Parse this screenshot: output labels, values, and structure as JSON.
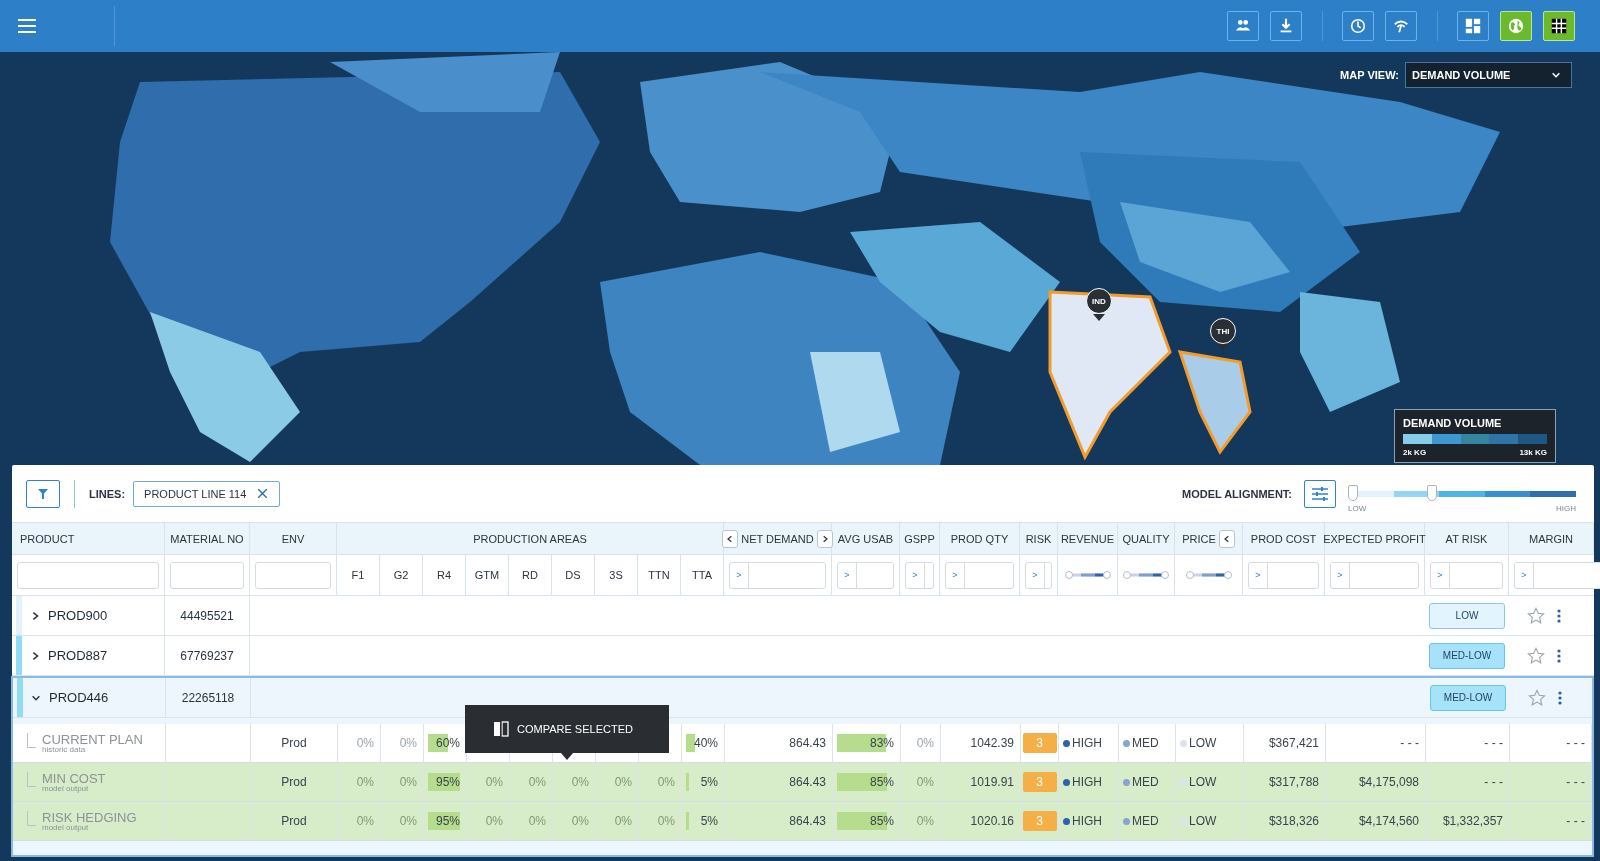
{
  "top_bar": {
    "buttons": [
      {
        "kind": "people",
        "selected": false
      },
      {
        "kind": "download",
        "selected": false
      },
      {
        "kind": "clock",
        "selected": false
      },
      {
        "kind": "signal",
        "selected": false
      },
      {
        "kind": "dashboard",
        "selected": false
      },
      {
        "kind": "globe",
        "selected": true
      },
      {
        "kind": "grid",
        "selected": true
      }
    ]
  },
  "map": {
    "view_label": "MAP VIEW:",
    "view_value": "DEMAND VOLUME",
    "pins": [
      "IND",
      "THI"
    ],
    "legend": {
      "title": "DEMAND VOLUME",
      "min": "2k KG",
      "max": "13k KG"
    }
  },
  "toolbar": {
    "lines_label": "LINES:",
    "chip": "PRODUCT LINE 114",
    "alignment_label": "MODEL ALIGNMENT:",
    "slider": {
      "level": 0.37,
      "min_label": "LOW",
      "max_label": "HIGH"
    }
  },
  "columns": [
    {
      "label": "PRODUCT",
      "kind": "text"
    },
    {
      "label": "MATERIAL NO",
      "kind": "text"
    },
    {
      "label": "ENV",
      "kind": "text"
    },
    {
      "label": "PRODUCTION AREAS",
      "kind": "group",
      "sub": [
        "F1",
        "G2",
        "R4",
        "GTM",
        "RD",
        "DS",
        "3S",
        "TTN",
        "TTA"
      ]
    },
    {
      "label": "NET DEMAND",
      "kind": "compare",
      "operator": ">",
      "nav_before": true,
      "nav_after": true
    },
    {
      "label": "AVG USAB",
      "kind": "compare",
      "operator": ">"
    },
    {
      "label": "GSPP",
      "kind": "compare",
      "operator": ">"
    },
    {
      "label": "PROD QTY",
      "kind": "compare",
      "operator": ">"
    },
    {
      "label": "RISK",
      "kind": "compare",
      "operator": ">"
    },
    {
      "label": "REVENUE",
      "kind": "range",
      "level": 1
    },
    {
      "label": "QUALITY",
      "kind": "range",
      "level": 1
    },
    {
      "label": "PRICE",
      "kind": "range",
      "level": 1,
      "nav_after": true
    },
    {
      "label": "PROD COST",
      "kind": "compare",
      "operator": ">"
    },
    {
      "label": "EXPECTED PROFIT",
      "kind": "compare",
      "operator": ">"
    },
    {
      "label": "AT RISK",
      "kind": "compare",
      "operator": ">"
    },
    {
      "label": "MARGIN",
      "kind": "compare",
      "operator": ">"
    }
  ],
  "rows": [
    {
      "product": "PROD900",
      "material": "44495521",
      "expanded": false,
      "color": "#e0f3fb",
      "risk": {
        "label": "LOW",
        "kind": "low"
      },
      "starred": false
    },
    {
      "product": "PROD887",
      "material": "67769237",
      "expanded": false,
      "color": "#8fdcf8",
      "risk": {
        "label": "MED-LOW",
        "kind": "med-low"
      },
      "starred": false
    },
    {
      "product": "PROD446",
      "material": "22265118",
      "expanded": true,
      "color": "#8fdcf8",
      "risk": {
        "label": "MED-LOW",
        "kind": "med-low"
      },
      "starred": false,
      "children": [
        {
          "name": "CURRENT PLAN",
          "note": "historic data",
          "selected": false,
          "env": "Prod",
          "areas": [
            {
              "value": "0%",
              "kind": "idle"
            },
            {
              "value": "0%",
              "kind": "idle"
            },
            {
              "value": "60%",
              "kind": "bar",
              "level": 0.6
            }
          ],
          "areas_right": [
            {
              "value": "40%",
              "kind": "bar",
              "level": 0.25
            }
          ],
          "net_demand": "864.43",
          "avg_usab": {
            "value": "83%",
            "kind": "bar",
            "level": 0.83
          },
          "gspp": {
            "value": "0%",
            "kind": "idle"
          },
          "prod_qty": "1042.39",
          "risk": "3",
          "revenue": {
            "label": "HIGH",
            "color": "#2e62ad"
          },
          "quality": {
            "label": "MED",
            "color": "#8aa3cf"
          },
          "price": {
            "label": "LOW",
            "color": "#dde3ee"
          },
          "prod_cost": "$367,421",
          "expected_profit": "- - -",
          "at_risk": "- - -",
          "margin": "- - -"
        },
        {
          "name": "MIN COST",
          "note": "model output",
          "selected": true,
          "env": "Prod",
          "areas": [
            {
              "value": "0%",
              "kind": "idle"
            },
            {
              "value": "0%",
              "kind": "idle"
            },
            {
              "value": "95%",
              "kind": "bar",
              "level": 0.95
            },
            {
              "value": "0%",
              "kind": "idle"
            },
            {
              "value": "0%",
              "kind": "idle"
            },
            {
              "value": "0%",
              "kind": "idle"
            },
            {
              "value": "0%",
              "kind": "idle"
            },
            {
              "value": "0%",
              "kind": "idle"
            },
            {
              "value": "5%",
              "kind": "bar",
              "level": 0.1
            }
          ],
          "net_demand": "864.43",
          "avg_usab": {
            "value": "85%",
            "kind": "bar",
            "level": 0.85
          },
          "gspp": {
            "value": "0%",
            "kind": "idle"
          },
          "prod_qty": "1019.91",
          "risk": "3",
          "revenue": {
            "label": "HIGH",
            "color": "#2e62ad"
          },
          "quality": {
            "label": "MED",
            "color": "#8aa3cf"
          },
          "price": {
            "label": "LOW",
            "color": "#dde3ee"
          },
          "prod_cost": "$317,788",
          "expected_profit": "$4,175,098",
          "at_risk": "- - -",
          "margin": "- - -"
        },
        {
          "name": "RISK HEDGING",
          "note": "model output",
          "selected": true,
          "env": "Prod",
          "areas": [
            {
              "value": "0%",
              "kind": "idle"
            },
            {
              "value": "0%",
              "kind": "idle"
            },
            {
              "value": "95%",
              "kind": "bar",
              "level": 0.95
            },
            {
              "value": "0%",
              "kind": "idle"
            },
            {
              "value": "0%",
              "kind": "idle"
            },
            {
              "value": "0%",
              "kind": "idle"
            },
            {
              "value": "0%",
              "kind": "idle"
            },
            {
              "value": "0%",
              "kind": "idle"
            },
            {
              "value": "5%",
              "kind": "bar",
              "level": 0.1
            }
          ],
          "net_demand": "864.43",
          "avg_usab": {
            "value": "85%",
            "kind": "bar",
            "level": 0.85
          },
          "gspp": {
            "value": "0%",
            "kind": "idle"
          },
          "prod_qty": "1020.16",
          "risk": "3",
          "revenue": {
            "label": "HIGH",
            "color": "#2e62ad"
          },
          "quality": {
            "label": "MED",
            "color": "#8aa3cf"
          },
          "price": {
            "label": "LOW",
            "color": "#dde3ee"
          },
          "prod_cost": "$318,326",
          "expected_profit": "$4,174,560",
          "at_risk": "$1,332,357",
          "margin": "- - -"
        }
      ]
    }
  ],
  "tooltip": {
    "label": "COMPARE SELECTED"
  }
}
